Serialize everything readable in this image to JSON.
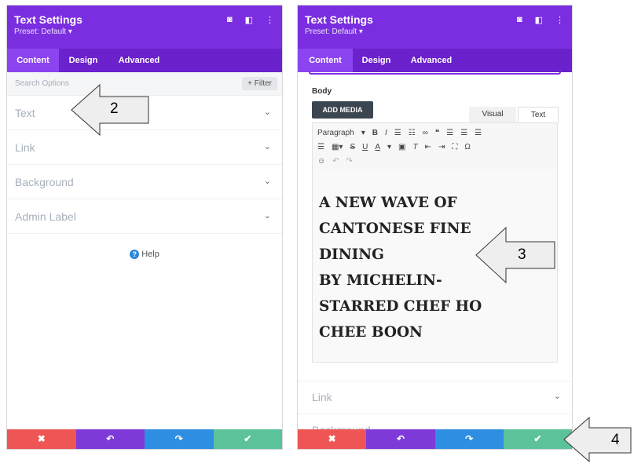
{
  "panel": {
    "title": "Text Settings",
    "preset": "Preset: Default ▾",
    "icons": [
      "◙",
      "◧",
      "⋮"
    ],
    "tabs": [
      "Content",
      "Design",
      "Advanced"
    ]
  },
  "left": {
    "search_placeholder": "Search Options",
    "filter_label": "+ Filter",
    "sections": [
      "Text",
      "Link",
      "Background",
      "Admin Label"
    ],
    "help_icon": "?",
    "help_label": "Help"
  },
  "right": {
    "body_label": "Body",
    "add_media": "ADD MEDIA",
    "visual_tab": "Visual",
    "text_tab": "Text",
    "paragraph": "Paragraph",
    "content_lines": [
      "A NEW WAVE OF",
      "CANTONESE FINE",
      "DINING",
      "BY MICHELIN-",
      "STARRED CHEF HO",
      "CHEE BOON"
    ],
    "sections": [
      "Link",
      "Background"
    ]
  },
  "footer": {
    "cancel": "✖",
    "undo": "↶",
    "redo": "↷",
    "save": "✔"
  },
  "callouts": [
    "2",
    "3",
    "4"
  ],
  "colors": {
    "header": "#7b2ee0",
    "tabs": "#6b21cc",
    "red": "#ef5555",
    "purple": "#7e3ad8",
    "blue": "#2d8ee2",
    "green": "#5bc29a"
  }
}
